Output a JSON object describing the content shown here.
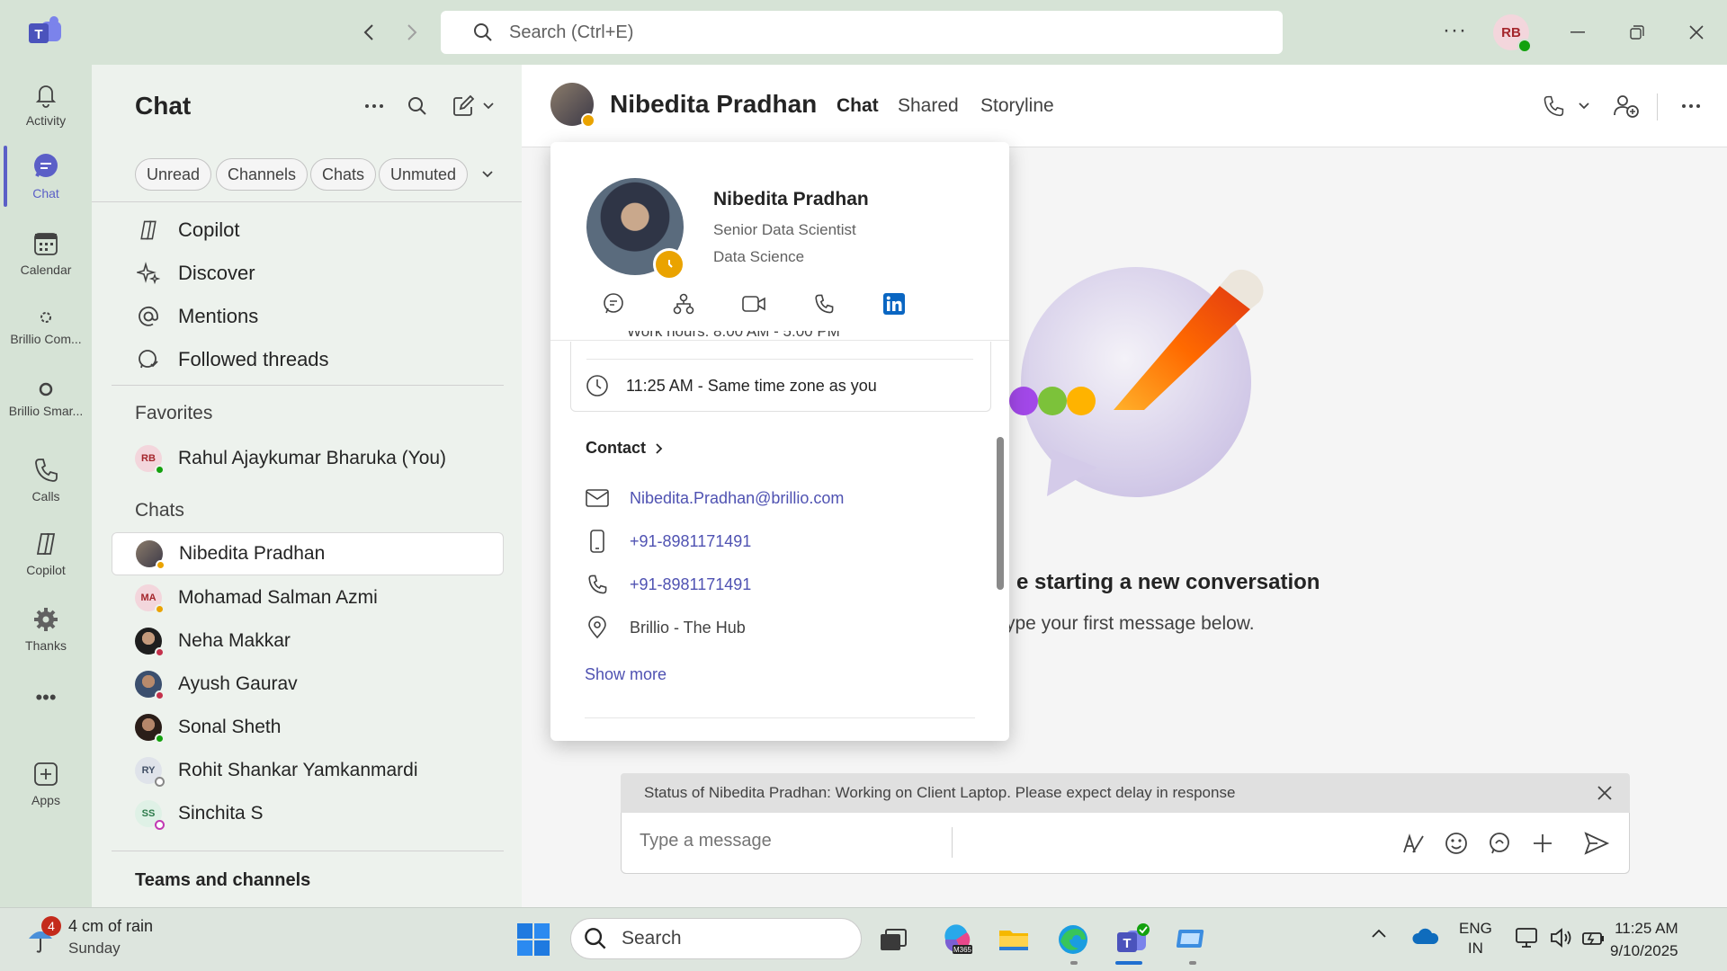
{
  "window": {
    "search_placeholder": "Search (Ctrl+E)",
    "user_initials": "RB",
    "more_label": "···"
  },
  "rail": {
    "items": [
      {
        "label": "Activity",
        "icon": "bell-icon"
      },
      {
        "label": "Chat",
        "icon": "chat-icon"
      },
      {
        "label": "Calendar",
        "icon": "calendar-icon"
      },
      {
        "label": "Brillio Com...",
        "icon": "app-icon"
      },
      {
        "label": "Brillio Smar...",
        "icon": "app-icon"
      },
      {
        "label": "Calls",
        "icon": "phone-icon"
      },
      {
        "label": "Copilot",
        "icon": "copilot-icon"
      },
      {
        "label": "Thanks",
        "icon": "gear-icon"
      },
      {
        "label": "Apps",
        "icon": "add-app-icon"
      }
    ],
    "more": "•••"
  },
  "chat_pane": {
    "title": "Chat",
    "filters": [
      "Unread",
      "Channels",
      "Chats",
      "Unmuted"
    ],
    "menu": [
      {
        "label": "Copilot",
        "icon": "copilot-icon"
      },
      {
        "label": "Discover",
        "icon": "sparkle-icon"
      },
      {
        "label": "Mentions",
        "icon": "at-icon"
      },
      {
        "label": "Followed threads",
        "icon": "followed-threads-icon"
      }
    ],
    "favorites_header": "Favorites",
    "favorites": [
      {
        "name": "Rahul Ajaykumar Bharuka (You)",
        "initials": "RB",
        "status": "available"
      }
    ],
    "chats_header": "Chats",
    "chats": [
      {
        "name": "Nibedita Pradhan",
        "initials": "",
        "status": "away",
        "selected": true
      },
      {
        "name": "Mohamad Salman Azmi",
        "initials": "MA",
        "status": "away"
      },
      {
        "name": "Neha Makkar",
        "initials": "",
        "status": "busy"
      },
      {
        "name": "Ayush Gaurav",
        "initials": "",
        "status": "busy"
      },
      {
        "name": "Sonal Sheth",
        "initials": "",
        "status": "available"
      },
      {
        "name": "Rohit Shankar Yamkanmardi",
        "initials": "RY",
        "status": "offline"
      },
      {
        "name": "Sinchita S",
        "initials": "SS",
        "status": "offline"
      }
    ],
    "teams_header": "Teams and channels"
  },
  "conversation": {
    "name": "Nibedita Pradhan",
    "tabs": [
      "Chat",
      "Shared",
      "Storyline"
    ],
    "active_tab": "Chat",
    "start_title": "e starting a new conversation",
    "start_sub": "ype your first message below.",
    "status_message": "Status of Nibedita Pradhan: Working on Client Laptop. Please expect delay in response",
    "compose_placeholder": "Type a message"
  },
  "profile_card": {
    "name": "Nibedita Pradhan",
    "title": "Senior Data Scientist",
    "department": "Data Science",
    "work_hours_partial": "Work hours: 8:00 AM - 5:00 PM",
    "local_time": "11:25 AM - Same time zone as you",
    "contact_header": "Contact",
    "email": "Nibedita.Pradhan@brillio.com",
    "mobile": "+91-8981171491",
    "phone": "+91-8981171491",
    "location": "Brillio - The Hub",
    "show_more": "Show more"
  },
  "taskbar": {
    "weather_badge": "4",
    "weather_line1": "4 cm of rain",
    "weather_line2": "Sunday",
    "search_label": "Search",
    "lang_line1": "ENG",
    "lang_line2": "IN",
    "time": "11:25 AM",
    "date": "9/10/2025"
  },
  "colors": {
    "accent": "#5b5fc7",
    "link": "#4f52b2",
    "available": "#13a10e",
    "away": "#eaa300",
    "busy": "#c4314b"
  }
}
